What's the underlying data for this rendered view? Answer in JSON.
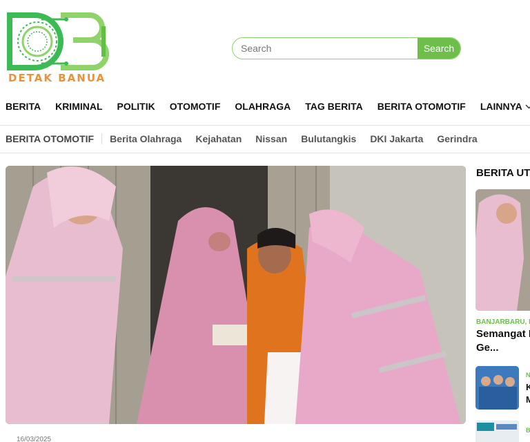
{
  "brand": {
    "name": "DETAK BANUA",
    "logo_colors": [
      "#3cba54",
      "#8fd36a"
    ],
    "accent": "#6cc04a",
    "tagline_color": "#e8923a"
  },
  "search": {
    "placeholder": "Search",
    "button_label": "Search"
  },
  "main_nav": {
    "items": [
      {
        "label": "BERITA"
      },
      {
        "label": "KRIMINAL"
      },
      {
        "label": "POLITIK"
      },
      {
        "label": "OTOMOTIF"
      },
      {
        "label": "OLAHRAGA"
      },
      {
        "label": "TAG BERITA"
      },
      {
        "label": "BERITA OTOMOTIF"
      },
      {
        "label": "LAINNYA"
      }
    ],
    "more_icon": "chevron-down-icon"
  },
  "tag_nav": {
    "items": [
      {
        "label": "BERITA OTOMOTIF"
      },
      {
        "label": "Berita Olahraga"
      },
      {
        "label": "Kejahatan"
      },
      {
        "label": "Nissan"
      },
      {
        "label": "Bulutangkis"
      },
      {
        "label": "DKI Jakarta"
      },
      {
        "label": "Gerindra"
      }
    ]
  },
  "hero": {
    "date": "16/03/2025"
  },
  "sidebar": {
    "title": "BERITA UTA",
    "featured": {
      "category": "BANJARBARU, P",
      "headline": "Semangat R Ge..."
    },
    "items": [
      {
        "category": "N",
        "headline": "K\nM"
      },
      {
        "category": "B",
        "headline": ""
      }
    ]
  }
}
